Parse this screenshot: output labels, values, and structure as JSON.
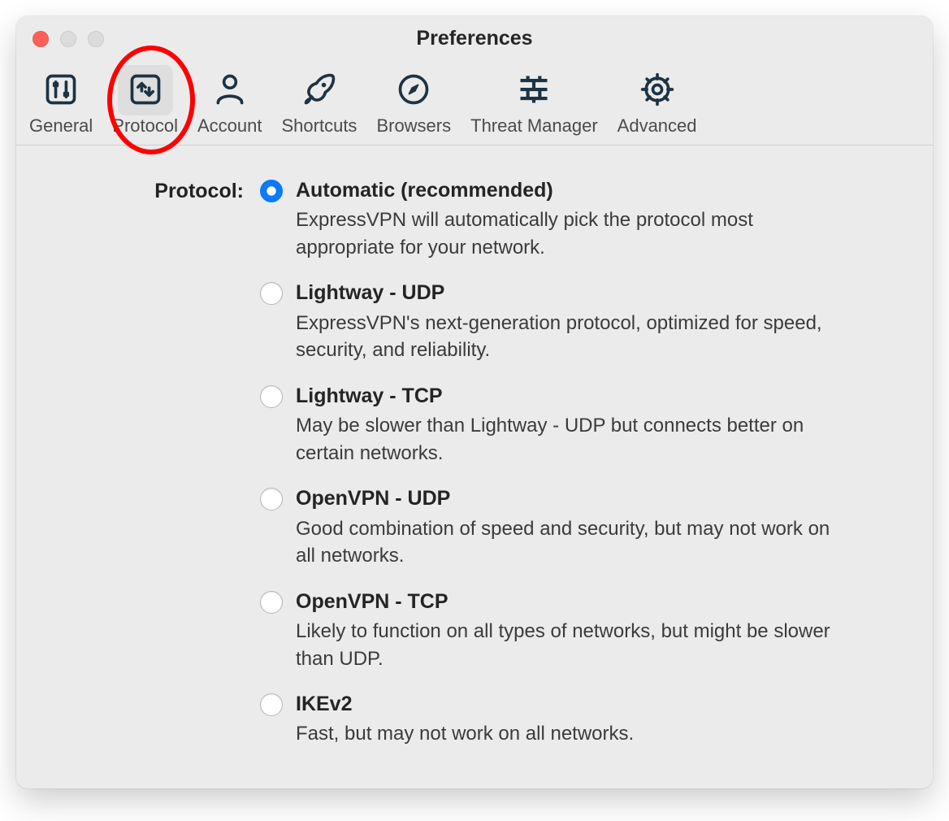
{
  "window": {
    "title": "Preferences"
  },
  "toolbar": {
    "items": [
      {
        "label": "General"
      },
      {
        "label": "Protocol"
      },
      {
        "label": "Account"
      },
      {
        "label": "Shortcuts"
      },
      {
        "label": "Browsers"
      },
      {
        "label": "Threat Manager"
      },
      {
        "label": "Advanced"
      }
    ],
    "selected_index": 1
  },
  "section": {
    "label": "Protocol:"
  },
  "protocol_options": [
    {
      "id": "automatic",
      "title": "Automatic (recommended)",
      "desc": "ExpressVPN will automatically pick the protocol most appropriate for your network.",
      "selected": true
    },
    {
      "id": "lightway-udp",
      "title": "Lightway - UDP",
      "desc": "ExpressVPN's next-generation protocol, optimized for speed, security, and reliability.",
      "selected": false
    },
    {
      "id": "lightway-tcp",
      "title": "Lightway - TCP",
      "desc": "May be slower than Lightway - UDP but connects better on certain networks.",
      "selected": false
    },
    {
      "id": "openvpn-udp",
      "title": "OpenVPN - UDP",
      "desc": "Good combination of speed and security, but may not work on all networks.",
      "selected": false
    },
    {
      "id": "openvpn-tcp",
      "title": "OpenVPN - TCP",
      "desc": "Likely to function on all types of networks, but might be slower than UDP.",
      "selected": false
    },
    {
      "id": "ikev2",
      "title": "IKEv2",
      "desc": "Fast, but may not work on all networks.",
      "selected": false
    }
  ],
  "colors": {
    "icon": "#1d3344",
    "accent": "#0a7aff",
    "highlight": "#ff0000"
  }
}
